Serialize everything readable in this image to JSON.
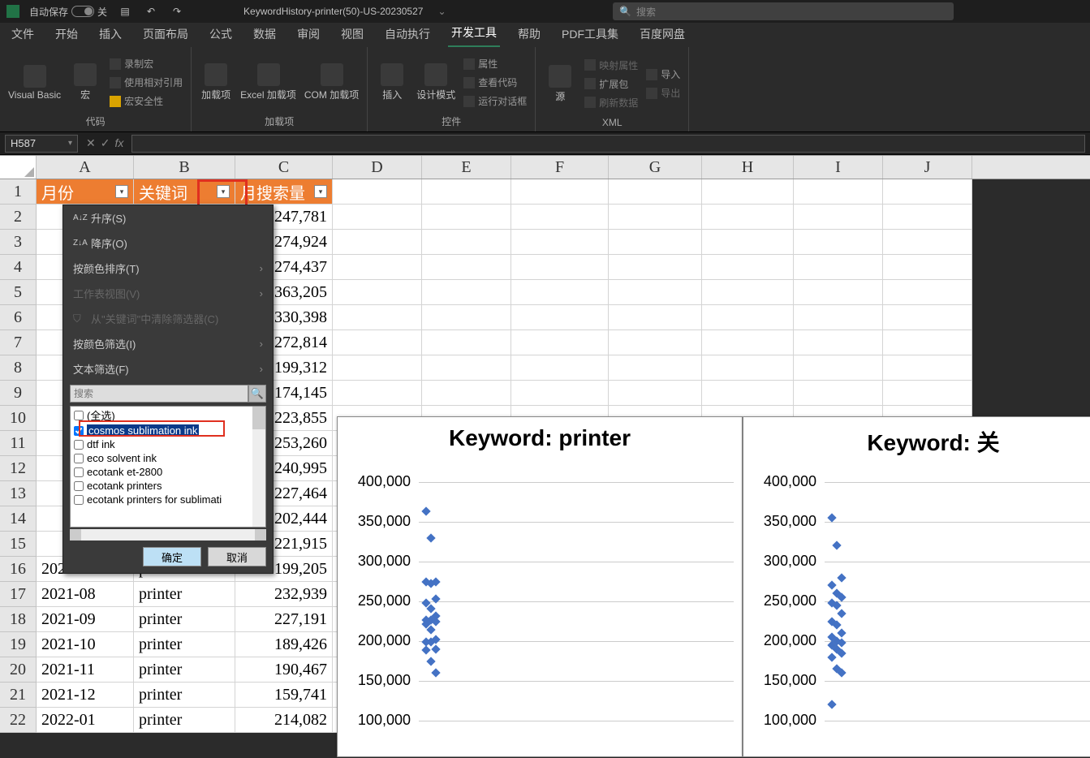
{
  "title_bar": {
    "autosave_label": "自动保存",
    "autosave_state": "关",
    "filename": "KeywordHistory-printer(50)-US-20230527",
    "search_placeholder": "搜索"
  },
  "tabs": {
    "file": "文件",
    "home": "开始",
    "insert": "插入",
    "pagelayout": "页面布局",
    "formulas": "公式",
    "data": "数据",
    "review": "审阅",
    "view": "视图",
    "automate": "自动执行",
    "developer": "开发工具",
    "help": "帮助",
    "pdf": "PDF工具集",
    "baidu": "百度网盘"
  },
  "ribbon": {
    "vb": "Visual Basic",
    "macro": "宏",
    "record": "录制宏",
    "userelref": "使用相对引用",
    "macrosec": "宏安全性",
    "code_label": "代码",
    "addins": "加载项",
    "excel_addin": "Excel 加载项",
    "com_addin": "COM 加载项",
    "addins_label": "加载项",
    "insert": "插入",
    "design": "设计模式",
    "properties": "属性",
    "viewcode": "查看代码",
    "rundialog": "运行对话框",
    "controls_label": "控件",
    "source": "源",
    "map_props": "映射属性",
    "extpack": "扩展包",
    "refresh": "刷新数据",
    "import": "导入",
    "export": "导出",
    "xml_label": "XML"
  },
  "namebox": "H587",
  "columns": [
    "A",
    "B",
    "C",
    "D",
    "E",
    "F",
    "G",
    "H",
    "I",
    "J"
  ],
  "headers": {
    "A": "月份",
    "B": "关键词",
    "C": "月搜索量"
  },
  "row_data": [
    {
      "n": 2,
      "C": "247,781"
    },
    {
      "n": 3,
      "C": "274,924"
    },
    {
      "n": 4,
      "C": "274,437"
    },
    {
      "n": 5,
      "C": "363,205"
    },
    {
      "n": 6,
      "C": "330,398"
    },
    {
      "n": 7,
      "C": "272,814"
    },
    {
      "n": 8,
      "C": "199,312"
    },
    {
      "n": 9,
      "C": "174,145"
    },
    {
      "n": 10,
      "C": "223,855"
    },
    {
      "n": 11,
      "C": "253,260"
    },
    {
      "n": 12,
      "C": "240,995"
    },
    {
      "n": 13,
      "C": "227,464"
    },
    {
      "n": 14,
      "C": "202,444"
    },
    {
      "n": 15,
      "C": "221,915"
    },
    {
      "n": 16,
      "A": "2021-07",
      "B": "printer",
      "C": "199,205"
    },
    {
      "n": 17,
      "A": "2021-08",
      "B": "printer",
      "C": "232,939"
    },
    {
      "n": 18,
      "A": "2021-09",
      "B": "printer",
      "C": "227,191"
    },
    {
      "n": 19,
      "A": "2021-10",
      "B": "printer",
      "C": "189,426"
    },
    {
      "n": 20,
      "A": "2021-11",
      "B": "printer",
      "C": "190,467"
    },
    {
      "n": 21,
      "A": "2021-12",
      "B": "printer",
      "C": "159,741"
    },
    {
      "n": 22,
      "A": "2022-01",
      "B": "printer",
      "C": "214,082"
    }
  ],
  "filter": {
    "sort_asc": "升序(S)",
    "sort_desc": "降序(O)",
    "sort_color": "按颜色排序(T)",
    "sheet_view": "工作表视图(V)",
    "clear_filter": "从\"关键词\"中清除筛选器(C)",
    "filter_color": "按颜色筛选(I)",
    "text_filters": "文本筛选(F)",
    "search_ph": "搜索",
    "items": [
      "(全选)",
      "cosmos sublimation ink",
      "dtf ink",
      "eco solvent ink",
      "ecotank et-2800",
      "ecotank printers",
      "ecotank printers for sublimati"
    ],
    "ok": "确定",
    "cancel": "取消"
  },
  "charts": {
    "c1": {
      "title": "Keyword: printer"
    },
    "c2": {
      "title": "Keyword: 关"
    },
    "ylabels": [
      "400,000",
      "350,000",
      "300,000",
      "250,000",
      "200,000",
      "150,000",
      "100,000"
    ]
  },
  "chart_data": [
    {
      "type": "scatter",
      "title": "Keyword: printer",
      "xlabel": "",
      "ylabel": "",
      "ylim": [
        100000,
        400000
      ],
      "series": [
        {
          "name": "printer",
          "values": [
            363000,
            330000,
            275000,
            274000,
            272000,
            253000,
            248000,
            241000,
            232000,
            227000,
            227000,
            224000,
            221000,
            214000,
            202000,
            199000,
            199000,
            190000,
            189000,
            174000,
            160000
          ]
        }
      ]
    },
    {
      "type": "scatter",
      "title": "Keyword: 关",
      "xlabel": "",
      "ylabel": "",
      "ylim": [
        100000,
        400000
      ],
      "series": [
        {
          "name": "",
          "values": [
            355000,
            320000,
            280000,
            270000,
            260000,
            255000,
            248000,
            245000,
            235000,
            225000,
            220000,
            210000,
            205000,
            200000,
            198000,
            195000,
            190000,
            185000,
            180000,
            165000,
            160000,
            120000
          ]
        }
      ]
    }
  ]
}
